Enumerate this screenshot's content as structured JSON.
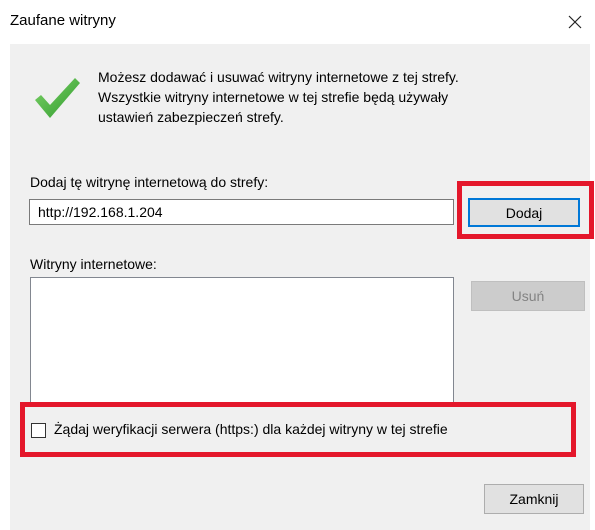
{
  "window": {
    "title": "Zaufane witryny",
    "close_icon": "close-icon"
  },
  "intro": {
    "icon": "checkmark-icon",
    "lines": [
      "Możesz dodawać i usuwać witryny internetowe z tej strefy.",
      "Wszystkie witryny internetowe w tej strefie będą używały",
      "ustawień zabezpieczeń strefy."
    ]
  },
  "add_section": {
    "label": "Dodaj tę witrynę internetową do strefy:",
    "url_value": "http://192.168.1.204",
    "add_button": "Dodaj"
  },
  "sites_section": {
    "label": "Witryny internetowe:",
    "items": [],
    "remove_button": "Usuń"
  },
  "verification": {
    "label": "Żądaj weryfikacji serwera (https:) dla każdej witryny w tej strefie",
    "checked": false
  },
  "footer": {
    "close_button": "Zamknij"
  },
  "colors": {
    "highlight": "#e4172b",
    "focus_border": "#0078d7",
    "checkmark_green": "#3aa635"
  }
}
